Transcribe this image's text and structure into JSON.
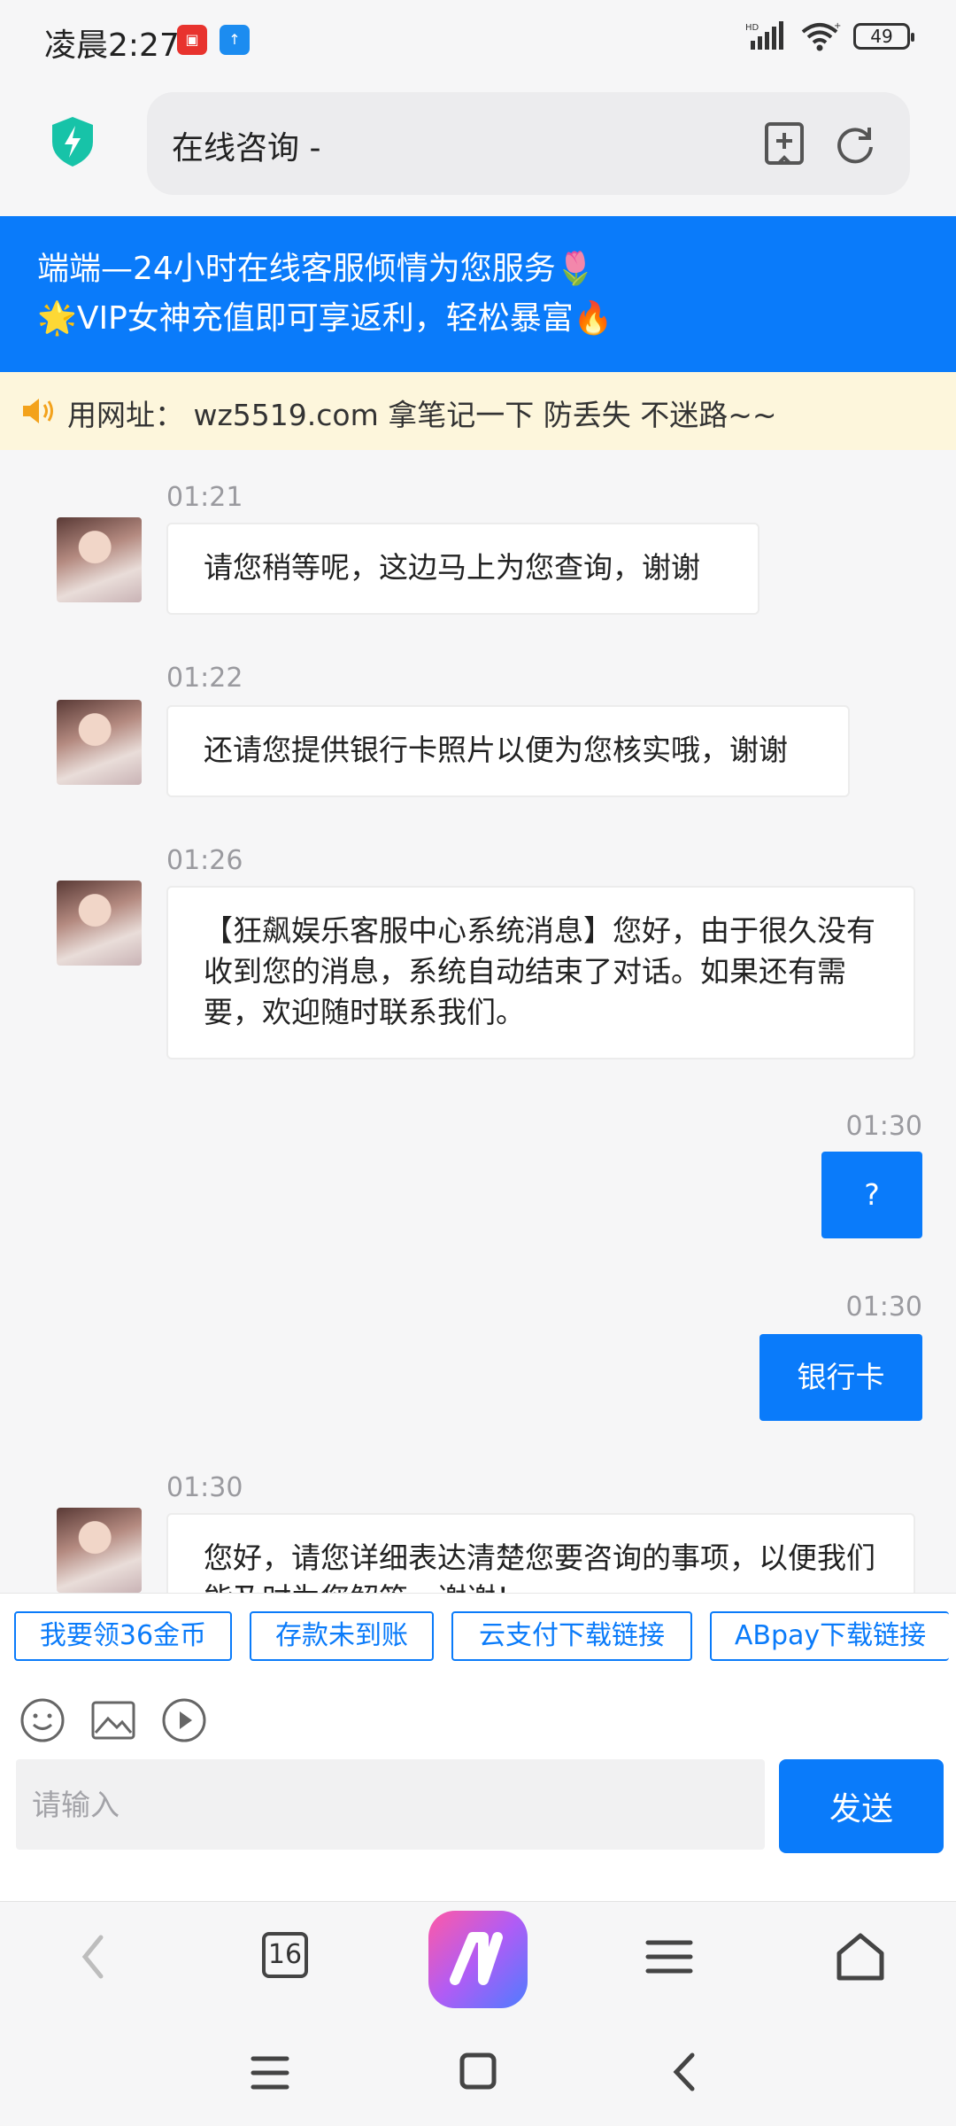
{
  "status": {
    "time": "凌晨2:27",
    "network": "HD",
    "battery": "49"
  },
  "address": {
    "title": "在线咨询 -"
  },
  "notice": {
    "line1": "端端—24小时在线客服倾情为您服务🌷",
    "line2": "🌟VIP女神充值即可享返利，轻松暴富🔥"
  },
  "marquee": {
    "text": "用网址： wz5519.com 拿笔记一下 防丢失 不迷路~~"
  },
  "messages": [
    {
      "time": "01:21",
      "text": "请您稍等呢，这边马上为您查询，谢谢"
    },
    {
      "time": "01:22",
      "text": "还请您提供银行卡照片以便为您核实哦，谢谢"
    },
    {
      "time": "01:26",
      "text": "【狂飙娱乐客服中心系统消息】您好，由于很久没有收到您的消息，系统自动结束了对话。如果还有需要，欢迎随时联系我们。"
    },
    {
      "time": "01:30",
      "text": "?"
    },
    {
      "time": "01:30",
      "text": "银行卡"
    },
    {
      "time": "01:30",
      "text": "您好，请您详细表达清楚您要咨询的事项，以便我们能及时为您解答，谢谢！"
    }
  ],
  "quick_replies": [
    "我要领36金币",
    "存款未到账",
    "云支付下载链接",
    "ABpay下载链接"
  ],
  "composer": {
    "placeholder": "请输入",
    "send_label": "发送"
  },
  "browser": {
    "tab_count": "16"
  },
  "colors": {
    "accent": "#0a7bfa",
    "marquee_bg": "#fdf6dc"
  }
}
